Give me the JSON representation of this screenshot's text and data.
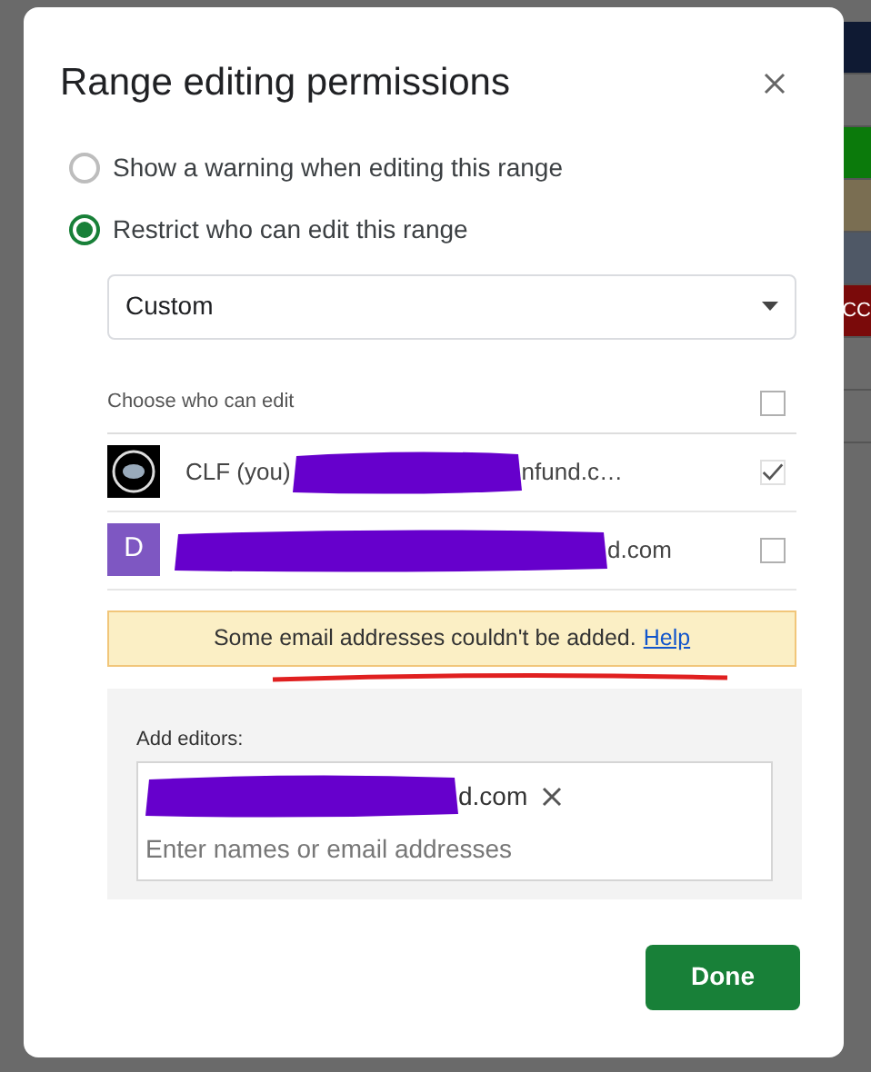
{
  "backdrop": {
    "cells": [
      {
        "color": "#0f1a33"
      },
      {
        "color": "#6b6b6b"
      },
      {
        "color": "#0b7a0b"
      },
      {
        "color": "#7a6e52"
      },
      {
        "color": "#4f5866"
      },
      {
        "color": "#7a0a0a",
        "text": "CC"
      },
      {
        "color": "#6b6b6b"
      },
      {
        "color": "#6b6b6b"
      }
    ]
  },
  "dialog": {
    "title": "Range editing permissions",
    "options": [
      {
        "label": "Show a warning when editing this range",
        "selected": false
      },
      {
        "label": "Restrict who can edit this range",
        "selected": true
      }
    ],
    "dropdown": {
      "value": "Custom"
    },
    "editors_header": {
      "label": "Choose who can edit",
      "checked": false
    },
    "editors": [
      {
        "kind": "logo",
        "name": "CLF (you)",
        "email_visible": "nfund.c…",
        "checked": true,
        "disabled": true
      },
      {
        "kind": "initial",
        "initial": "D",
        "color": "#7e57c2",
        "email_visible": "d.com",
        "checked": false,
        "disabled": false
      }
    ],
    "warning": {
      "text": "Some email addresses couldn't be added.",
      "link": "Help"
    },
    "add_editors": {
      "label": "Add editors:",
      "chips": [
        {
          "email_visible": "d.com"
        }
      ],
      "placeholder": "Enter names or email addresses"
    },
    "done": "Done"
  }
}
